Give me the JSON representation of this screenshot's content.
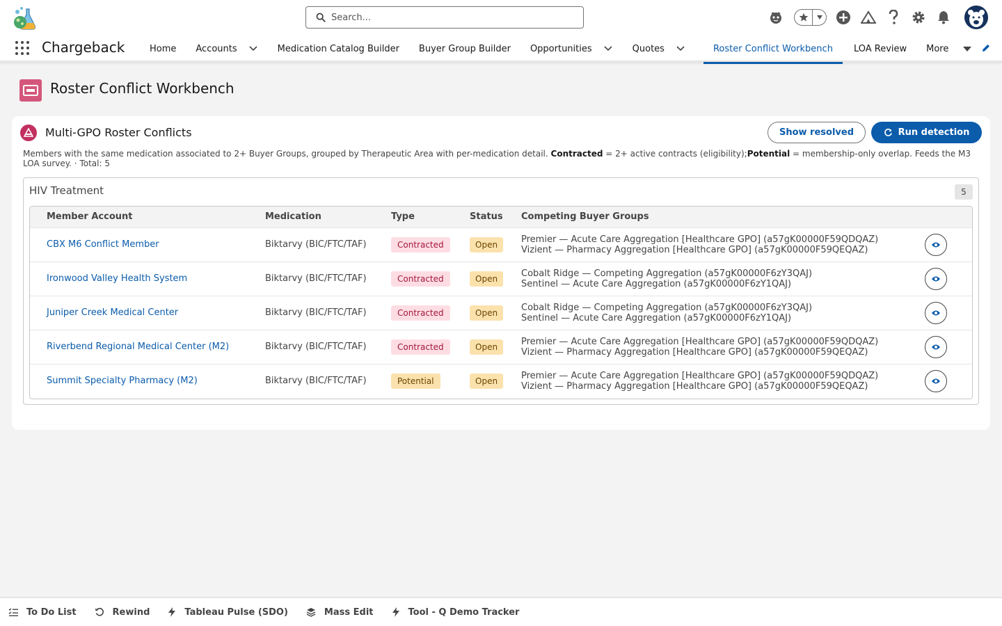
{
  "header": {
    "search_placeholder": "Search..."
  },
  "nav": {
    "app_name": "Chargeback",
    "items": [
      {
        "label": "Home",
        "dropdown": false
      },
      {
        "label": "Accounts",
        "dropdown": true
      },
      {
        "label": "Medication Catalog Builder",
        "dropdown": false
      },
      {
        "label": "Buyer Group Builder",
        "dropdown": false
      },
      {
        "label": "Opportunities",
        "dropdown": true
      },
      {
        "label": "Quotes",
        "dropdown": true
      },
      {
        "label": "Roster Conflict Workbench",
        "dropdown": false,
        "active": true
      },
      {
        "label": "LOA Review",
        "dropdown": false
      },
      {
        "label": "More",
        "dropdown": true
      }
    ]
  },
  "page": {
    "title": "Roster Conflict Workbench"
  },
  "card": {
    "title": "Multi-GPO Roster Conflicts",
    "show_resolved_label": "Show resolved",
    "run_detection_label": "Run detection",
    "desc_intro": "Members with the same medication associated to 2+ Buyer Groups, grouped by Therapeutic Area with per-medication detail. ",
    "desc_contracted_term": "Contracted",
    "desc_contracted_text": " = 2+ active contracts (eligibility);",
    "desc_potential_term": "Potential",
    "desc_potential_text": " = membership-only overlap. Feeds the M3 LOA survey. · Total: 5"
  },
  "group": {
    "title": "HIV Treatment",
    "count": "5",
    "columns": [
      "Member Account",
      "Medication",
      "Type",
      "Status",
      "Competing Buyer Groups"
    ],
    "rows": [
      {
        "member": "CBX M6 Conflict Member",
        "medication": "Biktarvy (BIC/FTC/TAF)",
        "type": "Contracted",
        "status": "Open",
        "groups": [
          "Premier — Acute Care Aggregation [Healthcare GPO] (a57gK00000F59QDQAZ)",
          "Vizient — Pharmacy Aggregation [Healthcare GPO] (a57gK00000F59QEQAZ)"
        ]
      },
      {
        "member": "Ironwood Valley Health System",
        "medication": "Biktarvy (BIC/FTC/TAF)",
        "type": "Contracted",
        "status": "Open",
        "groups": [
          "Cobalt Ridge — Competing Aggregation (a57gK00000F6zY3QAJ)",
          "Sentinel — Acute Care Aggregation (a57gK00000F6zY1QAJ)"
        ]
      },
      {
        "member": "Juniper Creek Medical Center",
        "medication": "Biktarvy (BIC/FTC/TAF)",
        "type": "Contracted",
        "status": "Open",
        "groups": [
          "Cobalt Ridge — Competing Aggregation (a57gK00000F6zY3QAJ)",
          "Sentinel — Acute Care Aggregation (a57gK00000F6zY1QAJ)"
        ]
      },
      {
        "member": "Riverbend Regional Medical Center (M2)",
        "medication": "Biktarvy (BIC/FTC/TAF)",
        "type": "Contracted",
        "status": "Open",
        "groups": [
          "Premier — Acute Care Aggregation [Healthcare GPO] (a57gK00000F59QDQAZ)",
          "Vizient — Pharmacy Aggregation [Healthcare GPO] (a57gK00000F59QEQAZ)"
        ]
      },
      {
        "member": "Summit Specialty Pharmacy (M2)",
        "medication": "Biktarvy (BIC/FTC/TAF)",
        "type": "Potential",
        "status": "Open",
        "groups": [
          "Premier — Acute Care Aggregation [Healthcare GPO] (a57gK00000F59QDQAZ)",
          "Vizient — Pharmacy Aggregation [Healthcare GPO] (a57gK00000F59QEQAZ)"
        ]
      }
    ]
  },
  "utility_bar": {
    "items": [
      {
        "label": "To Do List",
        "icon": "list-icon"
      },
      {
        "label": "Rewind",
        "icon": "rewind-icon"
      },
      {
        "label": "Tableau Pulse (SDO)",
        "icon": "lightning-icon"
      },
      {
        "label": "Mass Edit",
        "icon": "stack-icon"
      },
      {
        "label": "Tool - Q Demo Tracker",
        "icon": "lightning-icon"
      }
    ]
  },
  "colors": {
    "brand": "#0b5cab",
    "page_icon": "#d4577b",
    "card_icon": "#c23060"
  }
}
